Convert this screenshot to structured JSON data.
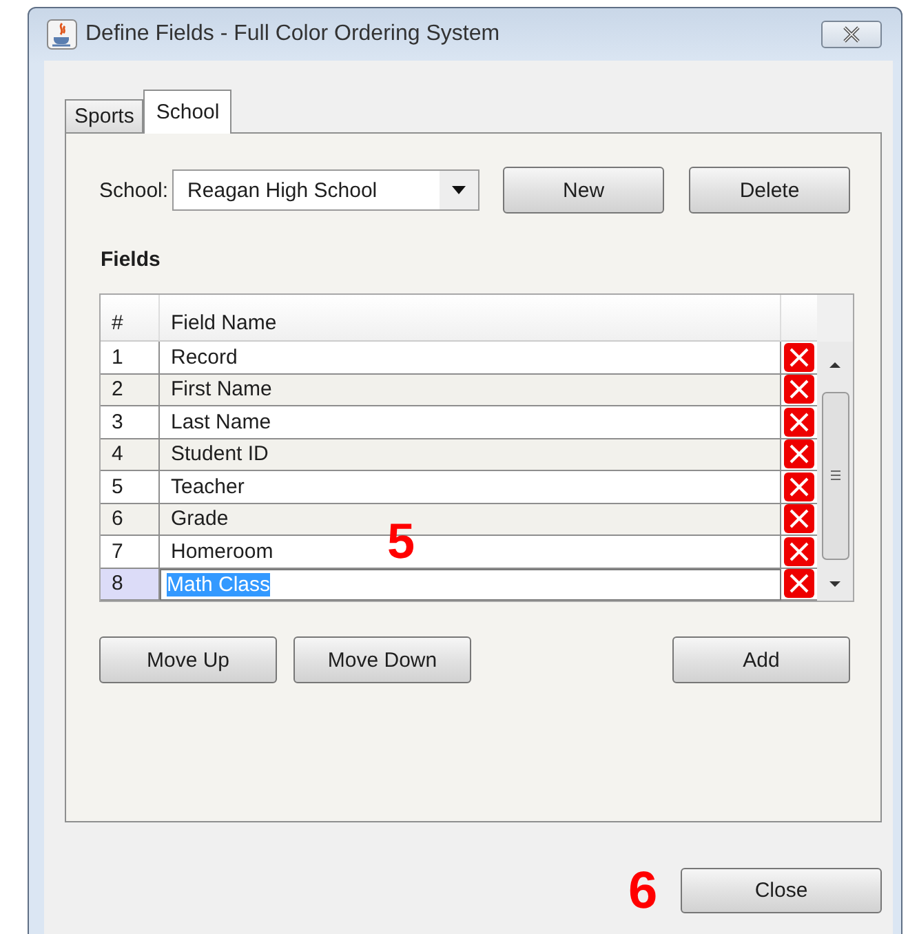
{
  "window": {
    "title": "Define Fields - Full Color Ordering System"
  },
  "tabs": [
    {
      "label": "Sports",
      "selected": false
    },
    {
      "label": "School",
      "selected": true
    }
  ],
  "school": {
    "label": "School:",
    "value": "Reagan High School"
  },
  "top_buttons": [
    "New",
    "Delete"
  ],
  "fields": {
    "heading": "Fields",
    "columns": [
      "#",
      "Field Name"
    ],
    "rows": [
      {
        "number": "1",
        "name": "Record",
        "selected": false
      },
      {
        "number": "2",
        "name": "First Name",
        "selected": false
      },
      {
        "number": "3",
        "name": "Last Name",
        "selected": false
      },
      {
        "number": "4",
        "name": "Student ID",
        "selected": false
      },
      {
        "number": "5",
        "name": "Teacher",
        "selected": false
      },
      {
        "number": "6",
        "name": "Grade",
        "selected": false
      },
      {
        "number": "7",
        "name": "Homeroom",
        "selected": false
      },
      {
        "number": "8",
        "name": "Math Class",
        "selected": true
      }
    ]
  },
  "bottom_buttons": [
    "Move Up",
    "Move Down",
    "Add"
  ],
  "close_button": "Close",
  "annotations": [
    "5",
    "6"
  ]
}
